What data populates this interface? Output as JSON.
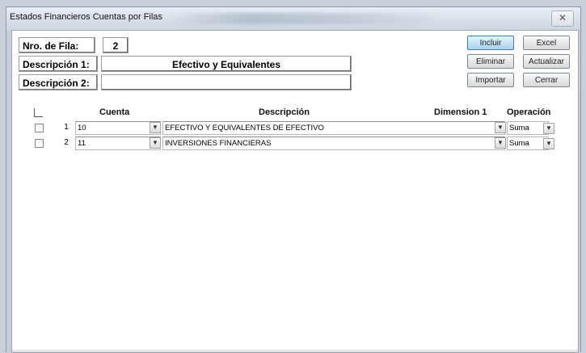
{
  "window": {
    "title": "Estados Financieros Cuentas por Filas",
    "close_symbol": "✕"
  },
  "form": {
    "row_label": "Nro. de Fila:",
    "row_value": "2",
    "desc1_label": "Descripción 1:",
    "desc1_value": "Efectivo y Equivalentes",
    "desc2_label": "Descripción 2:",
    "desc2_value": ""
  },
  "buttons": {
    "incluir": "Incluir",
    "excel": "Excel",
    "eliminar": "Eliminar",
    "actualizar": "Actualizar",
    "importar": "Importar",
    "cerrar": "Cerrar"
  },
  "grid": {
    "headers": {
      "cuenta": "Cuenta",
      "descripcion": "Descripción",
      "dimension1": "Dimension 1",
      "operacion": "Operación"
    },
    "rows": [
      {
        "num": "1",
        "cuenta": "10",
        "descripcion": "EFECTIVO Y EQUIVALENTES DE EFECTIVO",
        "operacion": "Suma"
      },
      {
        "num": "2",
        "cuenta": "11",
        "descripcion": "INVERSIONES FINANCIERAS",
        "operacion": "Suma"
      }
    ]
  },
  "icons": {
    "dropdown": "▼"
  }
}
